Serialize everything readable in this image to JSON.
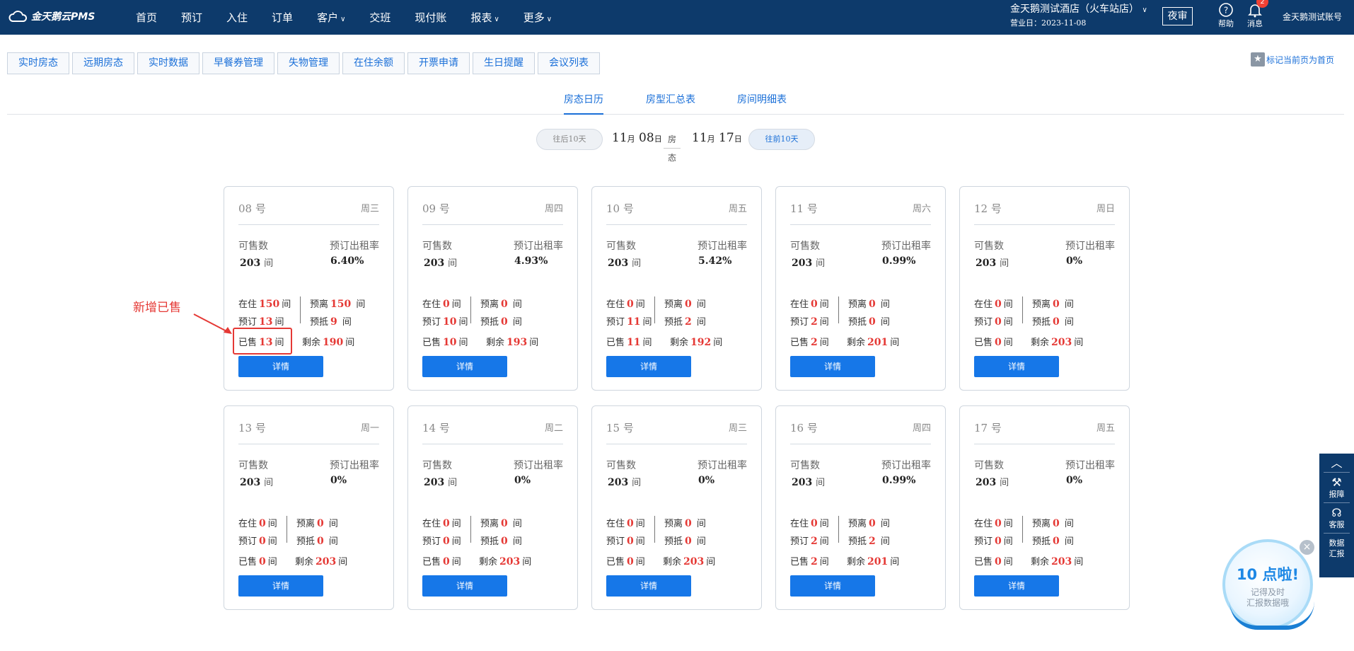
{
  "app": {
    "logo_text": "金天鹅云PMS"
  },
  "nav": [
    {
      "label": "首页",
      "dropdown": false
    },
    {
      "label": "预订",
      "dropdown": false
    },
    {
      "label": "入住",
      "dropdown": false
    },
    {
      "label": "订单",
      "dropdown": false
    },
    {
      "label": "客户",
      "dropdown": true
    },
    {
      "label": "交班",
      "dropdown": false
    },
    {
      "label": "现付账",
      "dropdown": false
    },
    {
      "label": "报表",
      "dropdown": true
    },
    {
      "label": "更多",
      "dropdown": true
    }
  ],
  "hotel": {
    "name": "金天鹅测试酒店（火车站店）",
    "business_day": "营业日：2023-11-08"
  },
  "night_audit": "夜审",
  "tools": {
    "help": "帮助",
    "messages": "消息",
    "message_count": "2"
  },
  "account": "金天鹅测试账号",
  "page_tabs": [
    "实时房态",
    "远期房态",
    "实时数据",
    "早餐券管理",
    "失物管理",
    "在住余额",
    "开票申请",
    "生日提醒",
    "会议列表"
  ],
  "mark_home": "标记当前页为首页",
  "view_tabs": [
    "房态日历",
    "房型汇总表",
    "房间明细表"
  ],
  "active_view": 0,
  "date_nav": {
    "prev": "往后10天",
    "next": "往前10天",
    "start_month": "11",
    "start_day": "08",
    "end_month": "11",
    "end_day": "17",
    "month_unit": "月",
    "day_unit": "日",
    "state_label": "房态"
  },
  "labels": {
    "available": "可售数",
    "occupancy": "预订出租率",
    "unit": "间",
    "in_house": "在住",
    "due_out": "预离",
    "reserved": "预订",
    "arriving": "预抵",
    "sold": "已售",
    "remaining": "剩余",
    "detail": "详情"
  },
  "annotation": "新增已售",
  "cards": [
    {
      "day": "08 号",
      "week": "周三",
      "available": "203",
      "rate": "6.40%",
      "in_house": "150",
      "due_out": "150",
      "reserved": "13",
      "arriving": "9",
      "sold": "13",
      "remaining": "190"
    },
    {
      "day": "09 号",
      "week": "周四",
      "available": "203",
      "rate": "4.93%",
      "in_house": "0",
      "due_out": "0",
      "reserved": "10",
      "arriving": "0",
      "sold": "10",
      "remaining": "193"
    },
    {
      "day": "10 号",
      "week": "周五",
      "available": "203",
      "rate": "5.42%",
      "in_house": "0",
      "due_out": "0",
      "reserved": "11",
      "arriving": "2",
      "sold": "11",
      "remaining": "192"
    },
    {
      "day": "11 号",
      "week": "周六",
      "available": "203",
      "rate": "0.99%",
      "in_house": "0",
      "due_out": "0",
      "reserved": "2",
      "arriving": "0",
      "sold": "2",
      "remaining": "201"
    },
    {
      "day": "12 号",
      "week": "周日",
      "available": "203",
      "rate": "0%",
      "in_house": "0",
      "due_out": "0",
      "reserved": "0",
      "arriving": "0",
      "sold": "0",
      "remaining": "203"
    },
    {
      "day": "13 号",
      "week": "周一",
      "available": "203",
      "rate": "0%",
      "in_house": "0",
      "due_out": "0",
      "reserved": "0",
      "arriving": "0",
      "sold": "0",
      "remaining": "203"
    },
    {
      "day": "14 号",
      "week": "周二",
      "available": "203",
      "rate": "0%",
      "in_house": "0",
      "due_out": "0",
      "reserved": "0",
      "arriving": "0",
      "sold": "0",
      "remaining": "203"
    },
    {
      "day": "15 号",
      "week": "周三",
      "available": "203",
      "rate": "0%",
      "in_house": "0",
      "due_out": "0",
      "reserved": "0",
      "arriving": "0",
      "sold": "0",
      "remaining": "203"
    },
    {
      "day": "16 号",
      "week": "周四",
      "available": "203",
      "rate": "0.99%",
      "in_house": "0",
      "due_out": "0",
      "reserved": "2",
      "arriving": "2",
      "sold": "2",
      "remaining": "201"
    },
    {
      "day": "17 号",
      "week": "周五",
      "available": "203",
      "rate": "0%",
      "in_house": "0",
      "due_out": "0",
      "reserved": "0",
      "arriving": "0",
      "sold": "0",
      "remaining": "203"
    }
  ],
  "side_panel": [
    "报障",
    "客服",
    "数据汇报"
  ],
  "promo": {
    "title": "10 点啦!",
    "line1": "记得及时",
    "line2": "汇报数据哦"
  },
  "colors": {
    "topbar": "#0d3a6b",
    "accent": "#1677e8",
    "highlight": "#e53935"
  }
}
